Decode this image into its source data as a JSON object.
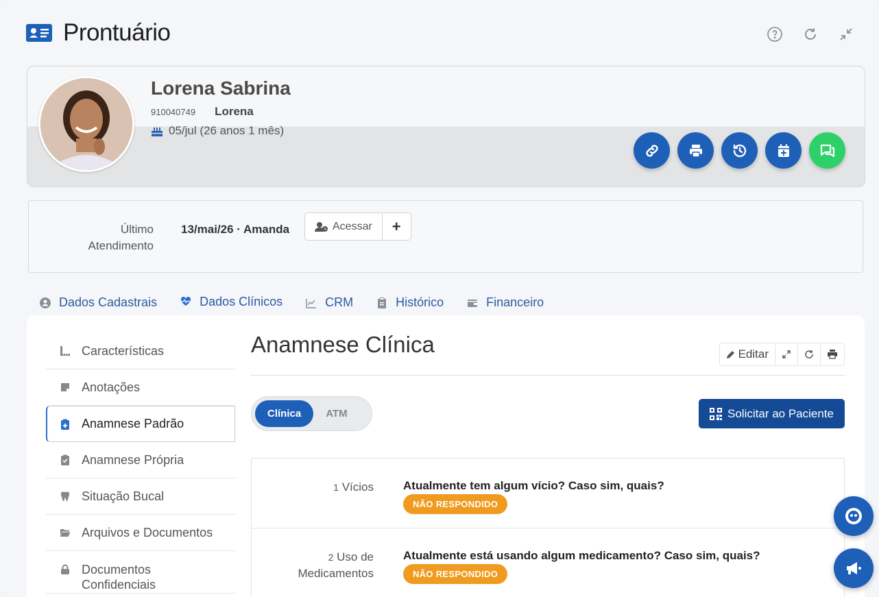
{
  "app": {
    "title": "Prontuário"
  },
  "header_tools": [
    "help-icon",
    "refresh-icon",
    "collapse-icon"
  ],
  "patient": {
    "name": "Lorena Sabrina",
    "id": "910040749",
    "nickname": "Lorena",
    "birthday": "05/jul (26 anos 1 mês)"
  },
  "actions": [
    {
      "name": "link-icon",
      "color": "#1e5fb8"
    },
    {
      "name": "print-icon",
      "color": "#1e5fb8"
    },
    {
      "name": "history-icon",
      "color": "#1e5fb8"
    },
    {
      "name": "calendar-add-icon",
      "color": "#1e5fb8"
    },
    {
      "name": "chat-icon",
      "color": "#2ed06a"
    }
  ],
  "last_visit": {
    "label": "Último Atendimento",
    "value": "13/mai/26 · Amanda",
    "access_label": "Acessar",
    "add_label": "+"
  },
  "tabs": [
    {
      "label": "Dados Cadastrais",
      "icon": "user-circle-icon",
      "active": false
    },
    {
      "label": "Dados Clínicos",
      "icon": "heart-pulse-icon",
      "active": true
    },
    {
      "label": "CRM",
      "icon": "chart-line-icon",
      "active": false
    },
    {
      "label": "Histórico",
      "icon": "clipboard-icon",
      "active": false
    },
    {
      "label": "Financeiro",
      "icon": "wallet-icon",
      "active": false
    }
  ],
  "side_menu": [
    {
      "label": "Características",
      "icon": "ruler-icon"
    },
    {
      "label": "Anotações",
      "icon": "note-icon"
    },
    {
      "label": "Anamnese Padrão",
      "icon": "clipboard-plus-icon"
    },
    {
      "label": "Anamnese Própria",
      "icon": "clipboard-check-icon"
    },
    {
      "label": "Situação Bucal",
      "icon": "tooth-icon"
    },
    {
      "label": "Arquivos e Documentos",
      "icon": "folder-open-icon"
    },
    {
      "label": "Documentos Confidenciais",
      "icon": "lock-icon"
    }
  ],
  "content": {
    "title": "Anamnese Clínica",
    "edit_label": "Editar",
    "segments": [
      "Clínica",
      "ATM"
    ],
    "request_label": "Solicitar ao Paciente",
    "questions": [
      {
        "num": "1",
        "label": "Vícios",
        "text": "Atualmente tem algum vício? Caso sim, quais?",
        "status": "NÃO RESPONDIDO"
      },
      {
        "num": "2",
        "label": "Uso de Medicamentos",
        "text": "Atualmente está usando algum medicamento? Caso sim, quais?",
        "status": "NÃO RESPONDIDO"
      }
    ]
  },
  "colors": {
    "primary": "#1e5fb8",
    "dark_primary": "#144a96",
    "whatsapp": "#2ed06a",
    "badge": "#f09a1e"
  }
}
